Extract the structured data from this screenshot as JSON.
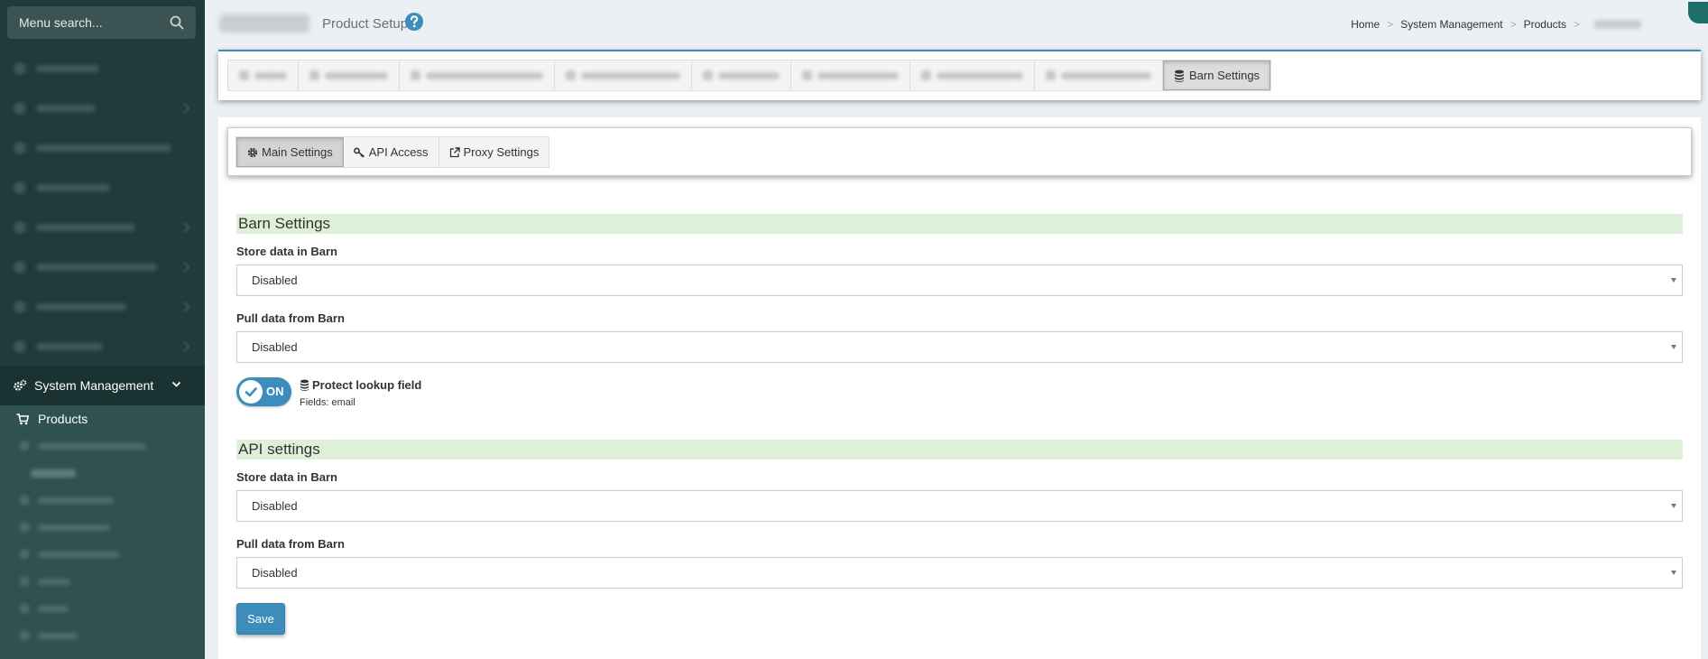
{
  "sidebar": {
    "search_placeholder": "Menu search...",
    "active_section": "System Management",
    "active_item": "Products"
  },
  "header": {
    "subtitle": "Product Setup",
    "breadcrumb": [
      "Home",
      "System Management",
      "Products"
    ]
  },
  "top_tabs": {
    "active_label": "Barn Settings"
  },
  "sub_tabs": [
    "Main Settings",
    "API Access",
    "Proxy Settings"
  ],
  "barn_settings": {
    "title": "Barn Settings",
    "store_label": "Store data in Barn",
    "store_value": "Disabled",
    "pull_label": "Pull data from Barn",
    "pull_value": "Disabled"
  },
  "protect": {
    "toggle_label": "ON",
    "label": "Protect lookup field",
    "fields": "Fields: email"
  },
  "api_settings": {
    "title": "API settings",
    "store_label": "Store data in Barn",
    "store_value": "Disabled",
    "pull_label": "Pull data from Barn",
    "pull_value": "Disabled"
  },
  "save_label": "Save",
  "colors": {
    "sidebar_bg": "#1f3b3a",
    "accent": "#3c8dbc",
    "section_bg": "#dff0d8"
  }
}
